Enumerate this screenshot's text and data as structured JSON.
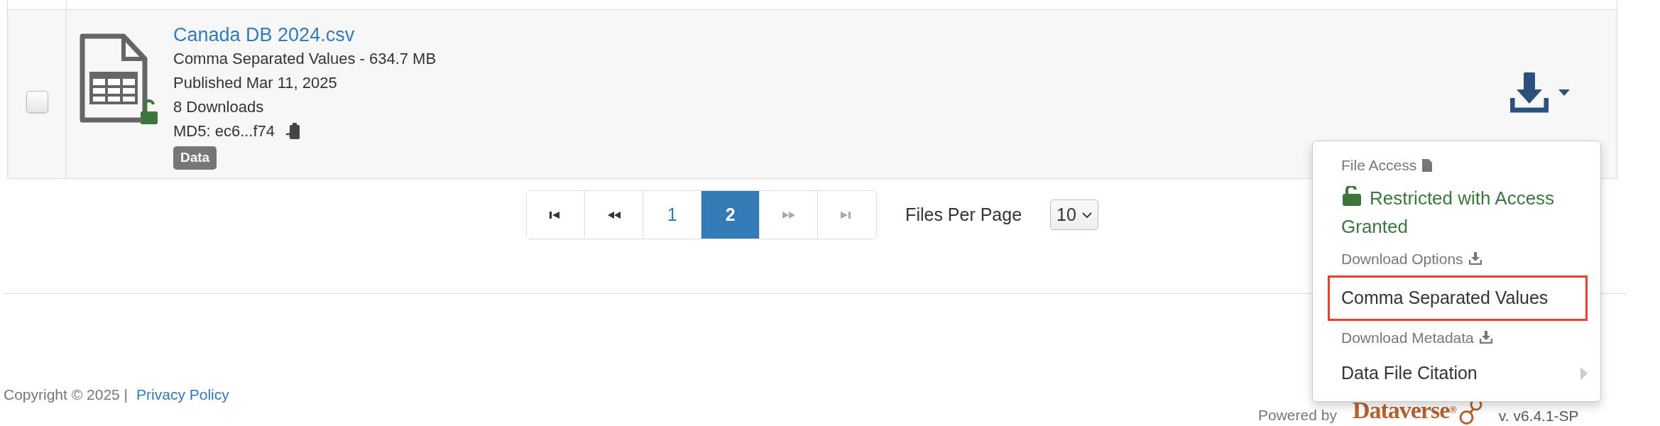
{
  "file": {
    "checked": false,
    "name": "Canada DB 2024.csv",
    "details": [
      "Comma Separated Values - 634.7 MB",
      "Published Mar 11, 2025",
      "8 Downloads"
    ],
    "md5": "MD5: ec6...f74",
    "tag": "Data"
  },
  "pagination": {
    "items": [
      {
        "kind": "first",
        "selected": false,
        "disabled": false
      },
      {
        "kind": "prev",
        "selected": false,
        "disabled": false
      },
      {
        "kind": "page",
        "label": "1",
        "selected": false,
        "disabled": false
      },
      {
        "kind": "page",
        "label": "2",
        "selected": true,
        "disabled": false
      },
      {
        "kind": "next",
        "selected": false,
        "disabled": true
      },
      {
        "kind": "last",
        "selected": false,
        "disabled": true
      }
    ]
  },
  "files_per_page": {
    "label": "Files Per Page",
    "value": "10"
  },
  "menu": {
    "items": [
      {
        "kind": "header",
        "text": "File Access",
        "highlighted": false
      },
      {
        "kind": "status",
        "text": "Restricted with Access Granted",
        "highlighted": false
      },
      {
        "kind": "header",
        "text": "Download Options",
        "highlighted": false
      },
      {
        "kind": "option",
        "text": "Comma Separated Values",
        "highlighted": true
      },
      {
        "kind": "header",
        "text": "Download Metadata",
        "highlighted": false
      },
      {
        "kind": "submenu",
        "text": "Data File Citation",
        "highlighted": false
      }
    ]
  },
  "footer": {
    "copyright": "Copyright © 2025 |",
    "privacy": "Privacy Policy",
    "powered": "Powered by",
    "logo": "Dataverse$^{®}$",
    "version": "v. v6.4.1-SP"
  }
}
